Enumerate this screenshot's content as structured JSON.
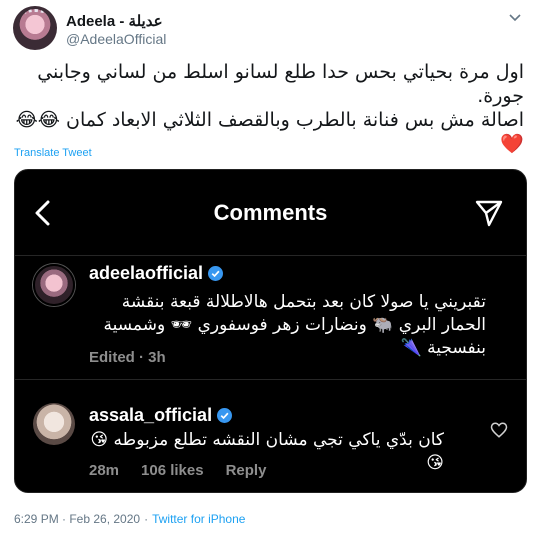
{
  "tweet": {
    "display_name": "Adeela - عديلة",
    "handle": "@AdeelaOfficial",
    "text_line1": "اول مرة بحياتي بحس حدا طلع لسانو اسلط من لساني وجابني جورة.",
    "text_line2": "اصالة مش بس فنانة بالطرب وبالقصف الثلاثي الابعاد كمان 😂😂",
    "heart": "❤️",
    "translate_label": "Translate Tweet",
    "timestamp": "6:29 PM · Feb 26, 2020",
    "separator": "·",
    "source": "Twitter for iPhone",
    "icons": {
      "caret": "chevron-down-icon"
    }
  },
  "instagram_screenshot": {
    "title": "Comments",
    "icons": {
      "back": "back-arrow-icon",
      "send": "paper-plane-icon",
      "verified": "verified-badge-icon",
      "like": "heart-outline-icon"
    },
    "comments": [
      {
        "username": "adeelaofficial",
        "text": "تقبريني يا صولا كان بعد بتحمل هالاطلالة قبعة بنقشة الحمار البري 🐃 ونضارات زهر فوسفوري 🕶 وشمسية بنفسجية 🌂",
        "time": "Edited · 3h"
      },
      {
        "username": "assala_official",
        "text": "كان بدّي ياكي تجي مشان النقشه تطلع مزبوطه 😘😘",
        "time": "28m",
        "likes": "106 likes",
        "reply": "Reply"
      }
    ]
  },
  "colors": {
    "twitter_blue": "#1da1f2",
    "instagram_bg": "#000000",
    "verified_blue": "#3897f0",
    "muted_gray": "#8e8e8e"
  }
}
